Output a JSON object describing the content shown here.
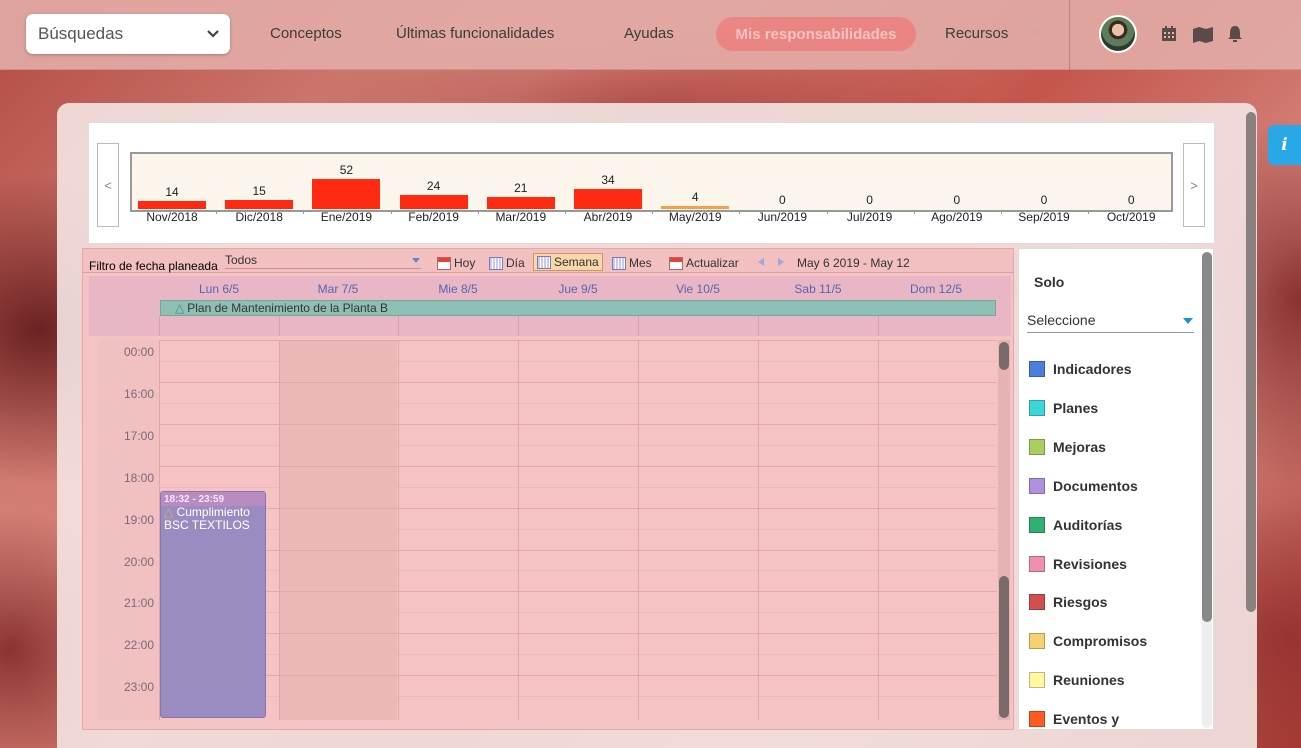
{
  "topbar": {
    "search_label": "Búsquedas",
    "nav": [
      "Conceptos",
      "Últimas funcionalidades",
      "Ayudas"
    ],
    "active_nav": "Mis responsabilidades",
    "resources": "Recursos"
  },
  "chart_data": {
    "type": "bar",
    "categories": [
      "Nov/2018",
      "Dic/2018",
      "Ene/2019",
      "Feb/2019",
      "Mar/2019",
      "Abr/2019",
      "May/2019",
      "Jun/2019",
      "Jul/2019",
      "Ago/2019",
      "Sep/2019",
      "Oct/2019"
    ],
    "values": [
      14,
      15,
      52,
      24,
      21,
      34,
      4,
      0,
      0,
      0,
      0,
      0
    ],
    "highlight_index": 6,
    "bar_color": "#ff2a12",
    "highlight_color": "#f5a04a",
    "grid": false,
    "title": "",
    "xlabel": "",
    "ylabel": ""
  },
  "calendar": {
    "filter_label": "Filtro de fecha planeada",
    "filter_value": "Todos",
    "buttons": {
      "today": "Hoy",
      "day": "Día",
      "week": "Semana",
      "month": "Mes",
      "refresh": "Actualizar"
    },
    "range": "May 6 2019 - May 12",
    "days": [
      "Lun 6/5",
      "Mar 7/5",
      "Mie 8/5",
      "Jue 9/5",
      "Vie 10/5",
      "Sab 11/5",
      "Dom 12/5"
    ],
    "allday_event": "Plan de Mantenimiento de la Planta B",
    "times": [
      "00:00",
      "16:00",
      "17:00",
      "18:00",
      "19:00",
      "20:00",
      "21:00",
      "22:00",
      "23:00"
    ],
    "event": {
      "time": "18:32 - 23:59",
      "title_line1": "Cumplimiento",
      "title_line2": "BSC TEXTILOS"
    }
  },
  "legend": {
    "title": "Solo",
    "select_value": "Seleccione",
    "items": [
      {
        "label": "Indicadores",
        "color": "#4a7fe0"
      },
      {
        "label": "Planes",
        "color": "#38d8d8"
      },
      {
        "label": "Mejoras",
        "color": "#a8d060"
      },
      {
        "label": "Documentos",
        "color": "#b090e0"
      },
      {
        "label": "Auditorías",
        "color": "#30b070"
      },
      {
        "label": "Revisiones",
        "color": "#f090b0"
      },
      {
        "label": "Riesgos",
        "color": "#d05050"
      },
      {
        "label": "Compromisos",
        "color": "#f8d070"
      },
      {
        "label": "Reuniones",
        "color": "#fff8a0"
      },
      {
        "label": "Eventos y",
        "color": "#ff5a20"
      }
    ]
  },
  "info_label": "i"
}
